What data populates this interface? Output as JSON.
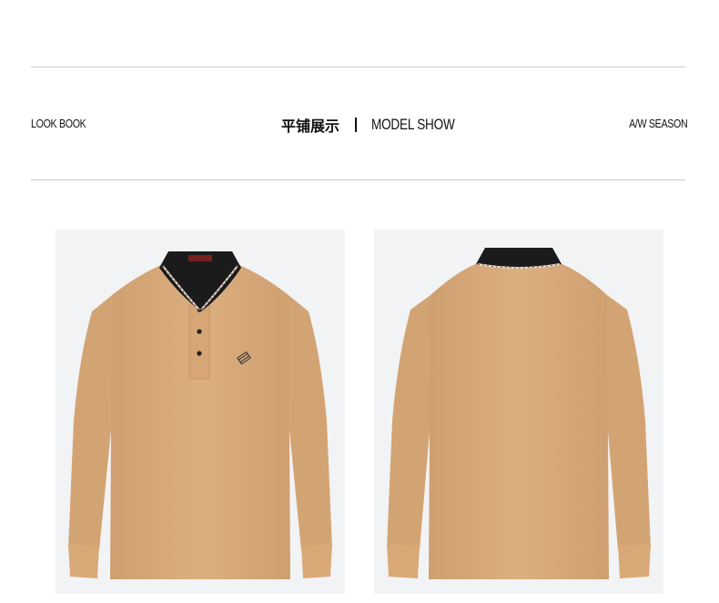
{
  "header": {
    "left_label": "LOOK BOOK",
    "title_cn": "平铺展示",
    "title_en": "MODEL SHOW",
    "right_label": "A/W SEASON"
  },
  "products": [
    {
      "view": "front",
      "icon": "polo-shirt-front-image"
    },
    {
      "view": "back",
      "icon": "polo-shirt-back-image"
    }
  ],
  "colors": {
    "shirt": "#d9ab7c",
    "collar": "#1a1a1a",
    "photo_bg": "#f2f3f5",
    "rule": "#c9c9c9"
  }
}
